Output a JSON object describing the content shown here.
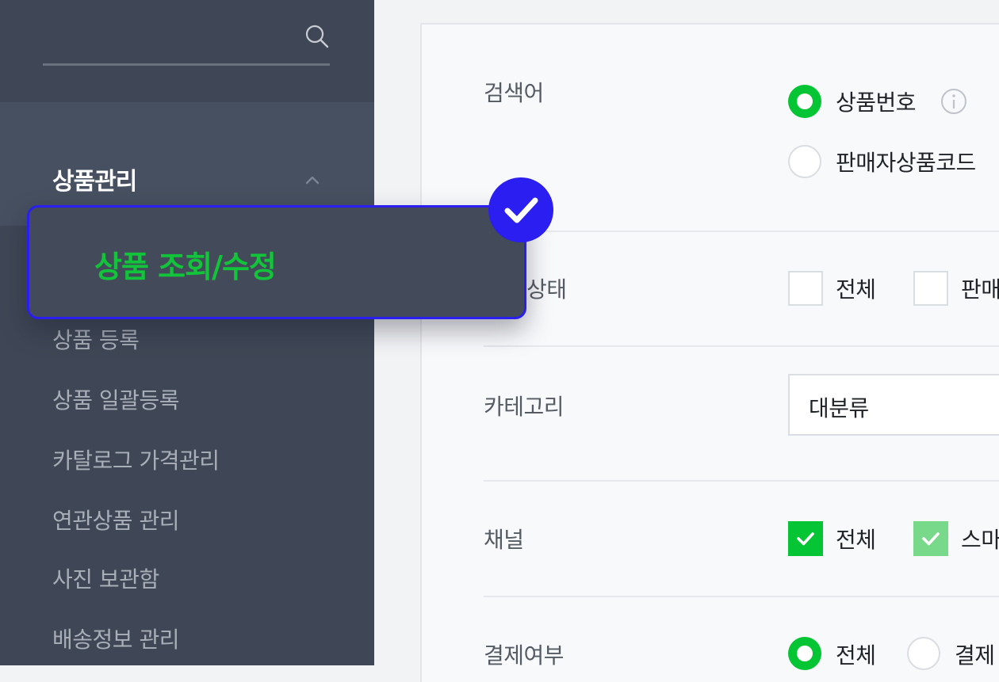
{
  "sidebar": {
    "search": {
      "value": "",
      "placeholder": ""
    },
    "group_title": "상품관리",
    "active_item": "상품 조회/수정",
    "items": [
      {
        "label": "상품 등록"
      },
      {
        "label": "상품 일괄등록"
      },
      {
        "label": "카탈로그 가격관리"
      },
      {
        "label": "연관상품 관리"
      },
      {
        "label": "사진 보관함"
      },
      {
        "label": "배송정보 관리"
      }
    ]
  },
  "main": {
    "search_term": {
      "label": "검색어",
      "options": [
        {
          "label": "상품번호",
          "selected": true
        },
        {
          "label": "판매자상품코드",
          "selected": false
        }
      ]
    },
    "status": {
      "label": "상태",
      "options": [
        {
          "label": "전체",
          "checked": false
        },
        {
          "label": "판매",
          "checked": false
        }
      ]
    },
    "category": {
      "label": "카테고리",
      "select_value": "대분류"
    },
    "channel": {
      "label": "채널",
      "options": [
        {
          "label": "전체",
          "checked": true
        },
        {
          "label": "스마",
          "checked": true
        }
      ]
    },
    "payment": {
      "label": "결제여부",
      "options": [
        {
          "label": "전체",
          "selected": true
        },
        {
          "label": "결제",
          "selected": false
        }
      ]
    }
  },
  "colors": {
    "sidebar_bg": "#3f4756",
    "accent_green": "#05c535",
    "highlight_border": "#2b1ef0",
    "active_text": "#12c43a"
  },
  "icons": [
    "search-icon",
    "chevron-up-icon",
    "info-icon",
    "check-badge-icon",
    "checkmark-icon"
  ]
}
